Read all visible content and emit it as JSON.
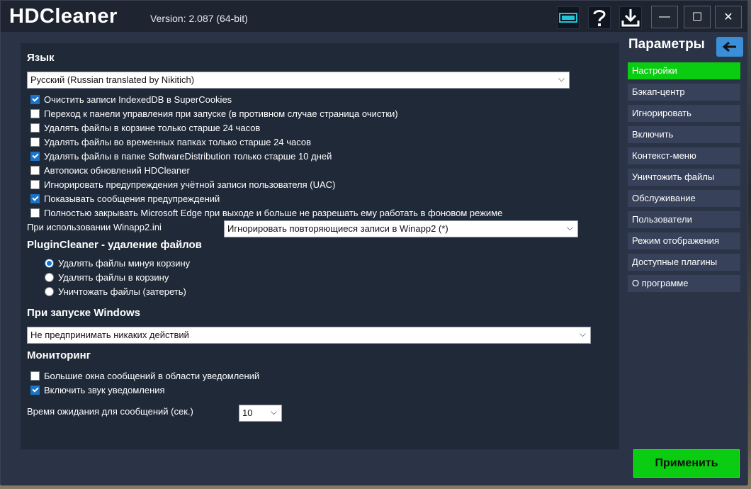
{
  "window": {
    "app_title": "HDCleaner",
    "version": "Version: 2.087 (64-bit)",
    "controls": {
      "minimize": "—",
      "maximize": "☐",
      "close": "✕"
    }
  },
  "language": {
    "title": "Язык",
    "selected": "Русский (Russian translated by Nikitich)"
  },
  "options": [
    {
      "label": "Очистить записи IndexedDB в SuperCookies",
      "checked": true
    },
    {
      "label": "Переход к панели управления при запуске (в противном случае страница очистки)",
      "checked": false
    },
    {
      "label": "Удалять файлы в корзине только старше 24 часов",
      "checked": false
    },
    {
      "label": "Удалять файлы во временных папках только старше 24 часов",
      "checked": false
    },
    {
      "label": "Удалять файлы в папке SoftwareDistribution только старше 10 дней",
      "checked": true
    },
    {
      "label": "Автопоиск обновлений HDCleaner",
      "checked": false
    },
    {
      "label": "Игнорировать предупреждения учётной записи пользователя (UAC)",
      "checked": false
    },
    {
      "label": "Показывать сообщения предупреждений",
      "checked": true
    },
    {
      "label": "Полностью закрывать Microsoft Edge при выходе и больше не разрешать ему работать в фоновом режиме",
      "checked": false
    }
  ],
  "winapp": {
    "label": "При использовании Winapp2.ini",
    "selected": "Игнорировать повторяющиеся записи в Winapp2 (*)"
  },
  "plugin_cleaner": {
    "title": "PluginCleaner - удаление файлов",
    "radios": [
      {
        "label": "Удалять файлы минуя корзину",
        "checked": true
      },
      {
        "label": "Удалять файлы в корзину",
        "checked": false
      },
      {
        "label": "Уничтожать файлы (затереть)",
        "checked": false
      }
    ]
  },
  "startup": {
    "title": "При запуске Windows",
    "selected": "Не предпринимать никаких действий"
  },
  "monitoring": {
    "title": "Мониторинг",
    "options": [
      {
        "label": "Большие окна сообщений в области уведомлений",
        "checked": false
      },
      {
        "label": "Включить звук уведомления",
        "checked": true
      }
    ],
    "timeout_label": "Время ожидания для сообщений (сек.)",
    "timeout_value": "10"
  },
  "sidebar": {
    "title": "Параметры",
    "items": [
      {
        "label": "Настройки",
        "active": true
      },
      {
        "label": "Бэкап-центр",
        "active": false
      },
      {
        "label": "Игнорировать",
        "active": false
      },
      {
        "label": "Включить",
        "active": false
      },
      {
        "label": "Контекст-меню",
        "active": false
      },
      {
        "label": "Уничтожить файлы",
        "active": false
      },
      {
        "label": "Обслуживание",
        "active": false
      },
      {
        "label": "Пользователи",
        "active": false
      },
      {
        "label": "Режим отображения",
        "active": false
      },
      {
        "label": "Доступные плагины",
        "active": false
      },
      {
        "label": "О программе",
        "active": false
      }
    ]
  },
  "apply_label": "Применить",
  "icons": {
    "toolbar": [
      "monitor-icon",
      "help-icon",
      "download-icon"
    ],
    "back": "arrow-left-icon"
  },
  "colors": {
    "accent_green": "#0acc10",
    "accent_blue": "#1a73c8",
    "sidebar_item": "#37425a"
  }
}
